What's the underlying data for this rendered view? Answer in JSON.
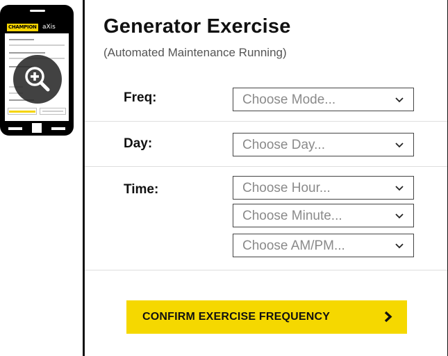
{
  "thumbnail": {
    "brand": "CHAMPION",
    "partner": "aXis",
    "icons": {
      "zoom": "zoom-in-icon",
      "home": "home-button-icon"
    }
  },
  "header": {
    "title": "Generator Exercise",
    "subtitle": "(Automated Maintenance Running)"
  },
  "form": {
    "freq": {
      "label": "Freq:",
      "value": "Choose Mode..."
    },
    "day": {
      "label": "Day:",
      "value": "Choose Day..."
    },
    "time": {
      "label": "Time:",
      "hour": "Choose Hour...",
      "minute": "Choose Minute...",
      "ampm": "Choose AM/PM..."
    }
  },
  "confirm": {
    "label": "CONFIRM EXERCISE FREQUENCY",
    "icon": "chevron-right-icon"
  },
  "colors": {
    "accent": "#f5d800",
    "border": "#444444",
    "placeholder": "#8a8a8a"
  }
}
